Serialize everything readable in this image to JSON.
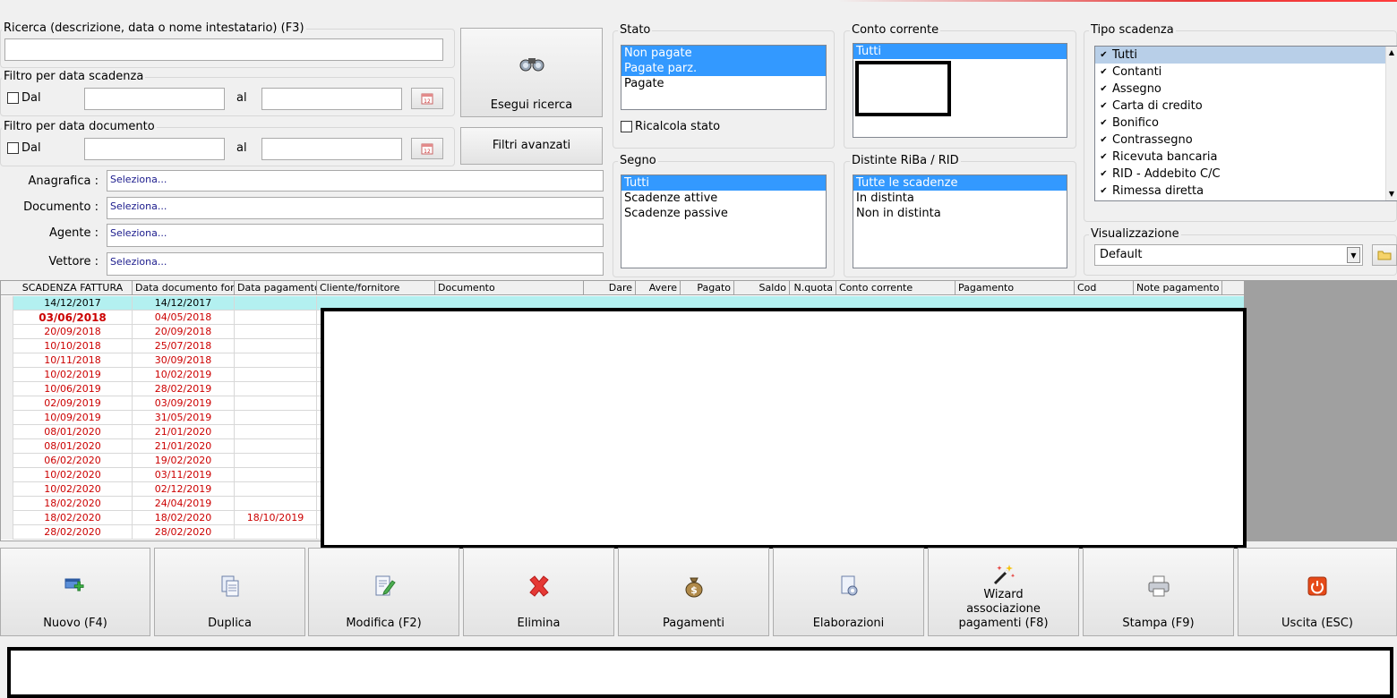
{
  "search": {
    "legend": "Ricerca (descrizione, data o nome intestatario) (F3)",
    "value": ""
  },
  "due_date_filter": {
    "legend": "Filtro per data scadenza",
    "from_label": "Dal",
    "to_label": "al"
  },
  "doc_date_filter": {
    "legend": "Filtro per data documento",
    "from_label": "Dal",
    "to_label": "al"
  },
  "buttons": {
    "search": "Esegui ricerca",
    "advanced": "Filtri avanzati"
  },
  "selectors": [
    {
      "label": "Anagrafica :",
      "value": "Seleziona..."
    },
    {
      "label": "Documento :",
      "value": "Seleziona..."
    },
    {
      "label": "Agente :",
      "value": "Seleziona..."
    },
    {
      "label": "Vettore :",
      "value": "Seleziona..."
    }
  ],
  "stato": {
    "legend": "Stato",
    "items": [
      {
        "label": "Non pagate",
        "selected": true
      },
      {
        "label": "Pagate parz.",
        "selected": true
      },
      {
        "label": "Pagate",
        "selected": false
      }
    ],
    "recalc_label": "Ricalcola stato"
  },
  "conto": {
    "legend": "Conto corrente",
    "items": [
      {
        "label": "Tutti",
        "selected": true
      }
    ]
  },
  "segno": {
    "legend": "Segno",
    "items": [
      {
        "label": "Tutti",
        "selected": true
      },
      {
        "label": "Scadenze attive",
        "selected": false
      },
      {
        "label": "Scadenze passive",
        "selected": false
      }
    ]
  },
  "distinte": {
    "legend": "Distinte RiBa / RID",
    "items": [
      {
        "label": "Tutte le scadenze",
        "selected": true
      },
      {
        "label": "In distinta",
        "selected": false
      },
      {
        "label": "Non in distinta",
        "selected": false
      }
    ]
  },
  "tipo": {
    "legend": "Tipo scadenza",
    "items": [
      {
        "label": "Tutti",
        "selected": true
      },
      {
        "label": "Contanti",
        "selected": false
      },
      {
        "label": "Assegno",
        "selected": false
      },
      {
        "label": "Carta di credito",
        "selected": false
      },
      {
        "label": "Bonifico",
        "selected": false
      },
      {
        "label": "Contrassegno",
        "selected": false
      },
      {
        "label": "Ricevuta bancaria",
        "selected": false
      },
      {
        "label": "RID - Addebito C/C",
        "selected": false
      },
      {
        "label": "Rimessa diretta",
        "selected": false
      }
    ]
  },
  "visualizzazione": {
    "legend": "Visualizzazione",
    "value": "Default"
  },
  "grid": {
    "columns": [
      "SCADENZA FATTURA",
      "Data documento forn",
      "Data pagamento",
      "Cliente/fornitore",
      "Documento",
      "Dare",
      "Avere",
      "Pagato",
      "Saldo",
      "N.quota",
      "Conto corrente",
      "Pagamento",
      "Cod",
      "Note pagamento"
    ],
    "rows": [
      [
        "14/12/2017",
        "14/12/2017",
        ""
      ],
      [
        "03/06/2018",
        "04/05/2018",
        ""
      ],
      [
        "20/09/2018",
        "20/09/2018",
        ""
      ],
      [
        "10/10/2018",
        "25/07/2018",
        ""
      ],
      [
        "10/11/2018",
        "30/09/2018",
        ""
      ],
      [
        "10/02/2019",
        "10/02/2019",
        ""
      ],
      [
        "10/06/2019",
        "28/02/2019",
        ""
      ],
      [
        "02/09/2019",
        "03/09/2019",
        ""
      ],
      [
        "10/09/2019",
        "31/05/2019",
        ""
      ],
      [
        "08/01/2020",
        "21/01/2020",
        ""
      ],
      [
        "08/01/2020",
        "21/01/2020",
        ""
      ],
      [
        "06/02/2020",
        "19/02/2020",
        ""
      ],
      [
        "10/02/2020",
        "03/11/2019",
        ""
      ],
      [
        "10/02/2020",
        "02/12/2019",
        ""
      ],
      [
        "18/02/2020",
        "24/04/2019",
        ""
      ],
      [
        "18/02/2020",
        "18/02/2020",
        "18/10/2019"
      ],
      [
        "28/02/2020",
        "28/02/2020",
        ""
      ]
    ]
  },
  "actions": [
    {
      "label": "Nuovo (F4)",
      "icon": "new-icon"
    },
    {
      "label": "Duplica",
      "icon": "duplicate-icon"
    },
    {
      "label": "Modifica (F2)",
      "icon": "edit-icon"
    },
    {
      "label": "Elimina",
      "icon": "delete-icon"
    },
    {
      "label": "Pagamenti",
      "icon": "money-bag-icon"
    },
    {
      "label": "Elaborazioni",
      "icon": "gear-document-icon"
    },
    {
      "label": "Wizard associazione pagamenti (F8)",
      "icon": "magic-wand-icon"
    },
    {
      "label": "Stampa (F9)",
      "icon": "printer-icon"
    },
    {
      "label": "Uscita (ESC)",
      "icon": "power-icon"
    }
  ],
  "colors": {
    "selection": "#3399ff",
    "overdue_text": "#cc0000",
    "grid_highlight": "#b3f0f0"
  }
}
